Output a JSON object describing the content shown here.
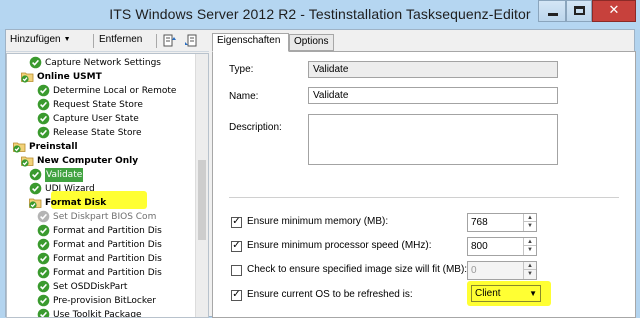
{
  "window": {
    "title": "ITS Windows Server 2012 R2 - Testinstallation Tasksequenz-Editor",
    "close_glyph": "✕"
  },
  "toolbar": {
    "add_label": "Hinzufügen",
    "remove_label": "Entfernen"
  },
  "tree": [
    {
      "label": "Capture Network Settings",
      "icon": "check-icon",
      "bold": false
    },
    {
      "label": "Online USMT",
      "icon": "folder-check-icon",
      "bold": true
    },
    {
      "label": "Determine Local or Remote",
      "icon": "check-icon",
      "bold": false
    },
    {
      "label": "Request State Store",
      "icon": "check-icon",
      "bold": false
    },
    {
      "label": "Capture User State",
      "icon": "check-icon",
      "bold": false
    },
    {
      "label": "Release State Store",
      "icon": "check-icon",
      "bold": false
    },
    {
      "label": "Preinstall",
      "icon": "folder-check-icon",
      "bold": true
    },
    {
      "label": "New Computer Only",
      "icon": "folder-check-icon",
      "bold": true
    },
    {
      "label": "Validate",
      "icon": "check-icon",
      "bold": false,
      "selected": true
    },
    {
      "label": "UDI Wizard",
      "icon": "check-icon",
      "bold": false
    },
    {
      "label": "Format Disk",
      "icon": "folder-check-icon",
      "bold": true
    },
    {
      "label": "Set Diskpart BIOS Com",
      "icon": "disabled-check-icon",
      "bold": false,
      "disabled": true
    },
    {
      "label": "Format and Partition Dis",
      "icon": "check-icon",
      "bold": false
    },
    {
      "label": "Format and Partition Dis",
      "icon": "check-icon",
      "bold": false
    },
    {
      "label": "Format and Partition Dis",
      "icon": "check-icon",
      "bold": false
    },
    {
      "label": "Format and Partition Dis",
      "icon": "check-icon",
      "bold": false
    },
    {
      "label": "Set OSDDiskPart",
      "icon": "check-icon",
      "bold": false
    },
    {
      "label": "Pre-provision BitLocker",
      "icon": "check-icon",
      "bold": false
    },
    {
      "label": "Use Toolkit Package",
      "icon": "check-icon",
      "bold": false
    }
  ],
  "tabs": {
    "properties": "Eigenschaften",
    "options": "Options"
  },
  "properties": {
    "type_label": "Type:",
    "type_value": "Validate",
    "name_label": "Name:",
    "name_value": "Validate",
    "description_label": "Description:",
    "description_value": ""
  },
  "checks": {
    "min_memory": {
      "label": "Ensure minimum memory (MB):",
      "checked": true,
      "value": "768"
    },
    "min_speed": {
      "label": "Ensure minimum processor speed (MHz):",
      "checked": true,
      "value": "800"
    },
    "image_size": {
      "label": "Check to ensure specified image size will fit (MB):",
      "checked": false,
      "value": "0"
    },
    "current_os": {
      "label": "Ensure current OS to be refreshed is:",
      "checked": true,
      "value": "Client"
    }
  },
  "colors": {
    "highlight": "#ffff33",
    "check_green": "#3a9a2e",
    "close_red": "#c7413c"
  }
}
